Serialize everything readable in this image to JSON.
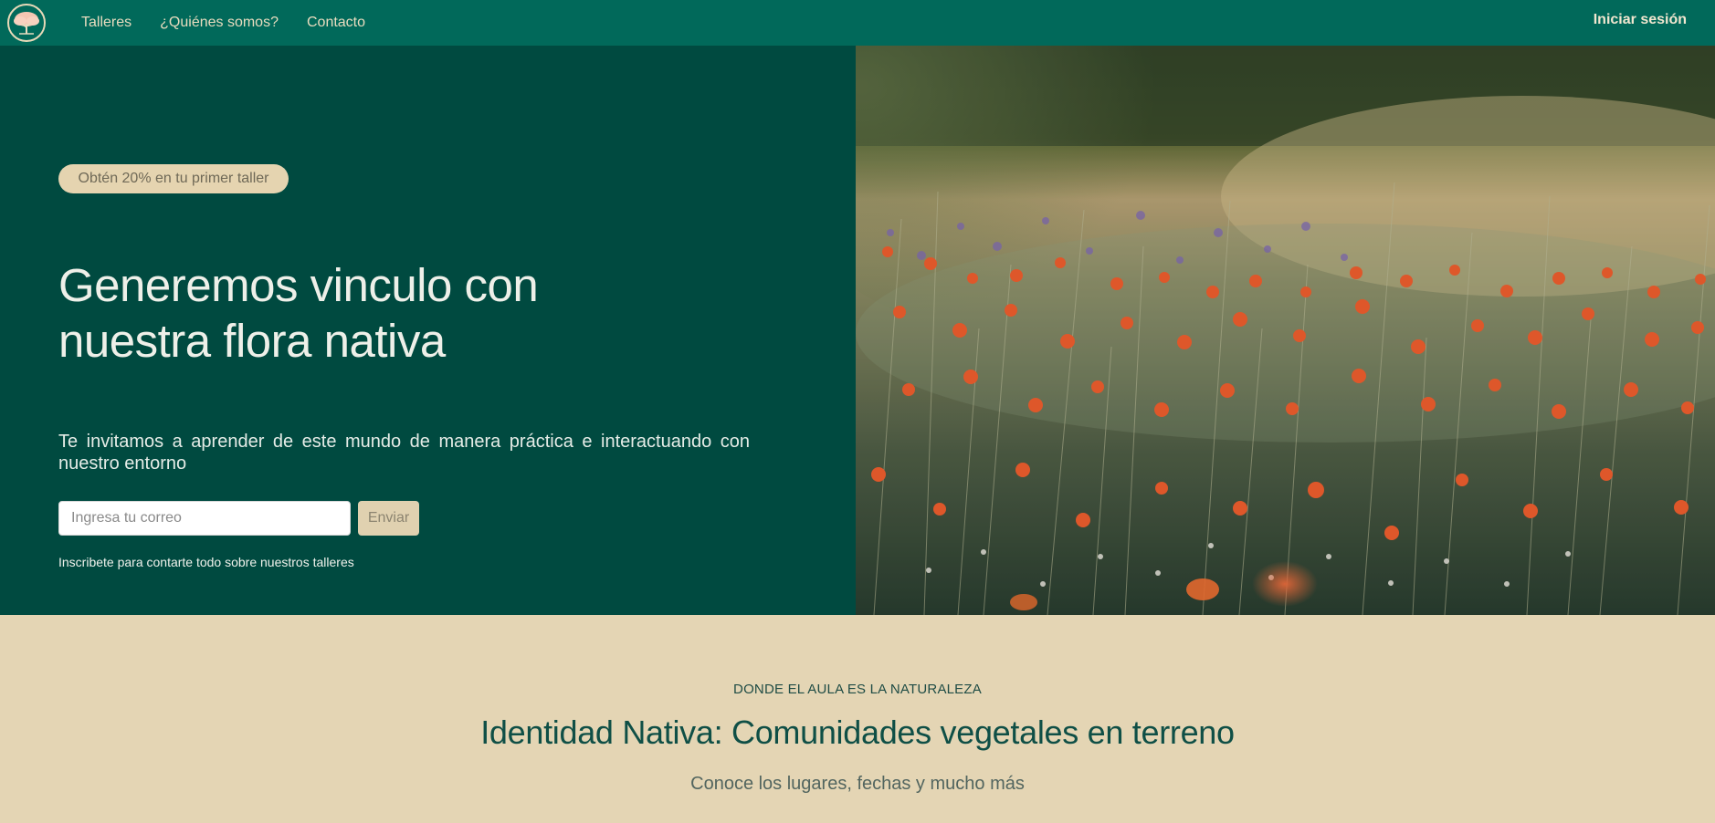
{
  "nav": {
    "links": [
      "Talleres",
      "¿Quiénes somos?",
      "Contacto"
    ],
    "login_label": "Iniciar sesión"
  },
  "hero": {
    "badge": "Obtén 20% en tu primer taller",
    "title_line1": "Generemos vinculo con",
    "title_line2": "nuestra flora nativa",
    "description": "Te invitamos a aprender de este mundo de manera práctica e interactuando con nuestro entorno",
    "email_placeholder": "Ingresa tu correo",
    "send_label": "Enviar",
    "note": "Inscribete para contarte todo sobre nuestros talleres"
  },
  "section": {
    "kicker": "DONDE EL AULA ES LA NATURALEZA",
    "title": "Identidad Nativa: Comunidades vegetales en terreno",
    "subtitle": "Conoce los lugares, fechas y mucho más"
  },
  "colors": {
    "nav_bg": "#01695a",
    "hero_bg": "#004a40",
    "accent": "#e5d4b0",
    "page_bg": "#e4d5b4"
  },
  "icons": {
    "logo": "tree-logo-icon"
  }
}
